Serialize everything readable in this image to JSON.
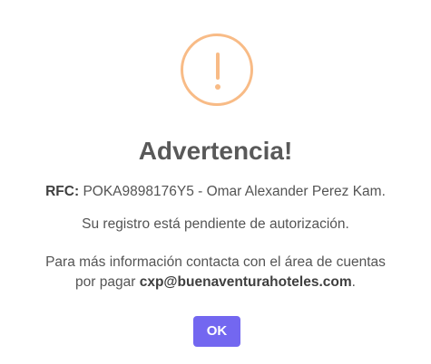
{
  "dialog": {
    "icon": "warning-exclamation-icon",
    "icon_color": "#f8bb86",
    "title": "Advertencia!",
    "rfc_label": "RFC:",
    "rfc_value": " POKA9898176Y5 - Omar Alexander Perez Kam.",
    "status_message": "Su registro está pendiente de autorización.",
    "info_text_1": "Para más información contacta con el área de cuentas",
    "info_text_2_prefix": "por pagar ",
    "contact_email": "cxp@buenaventurahoteles.com",
    "info_text_2_suffix": ".",
    "confirm_button_label": "OK",
    "confirm_button_color": "#7367f0"
  }
}
